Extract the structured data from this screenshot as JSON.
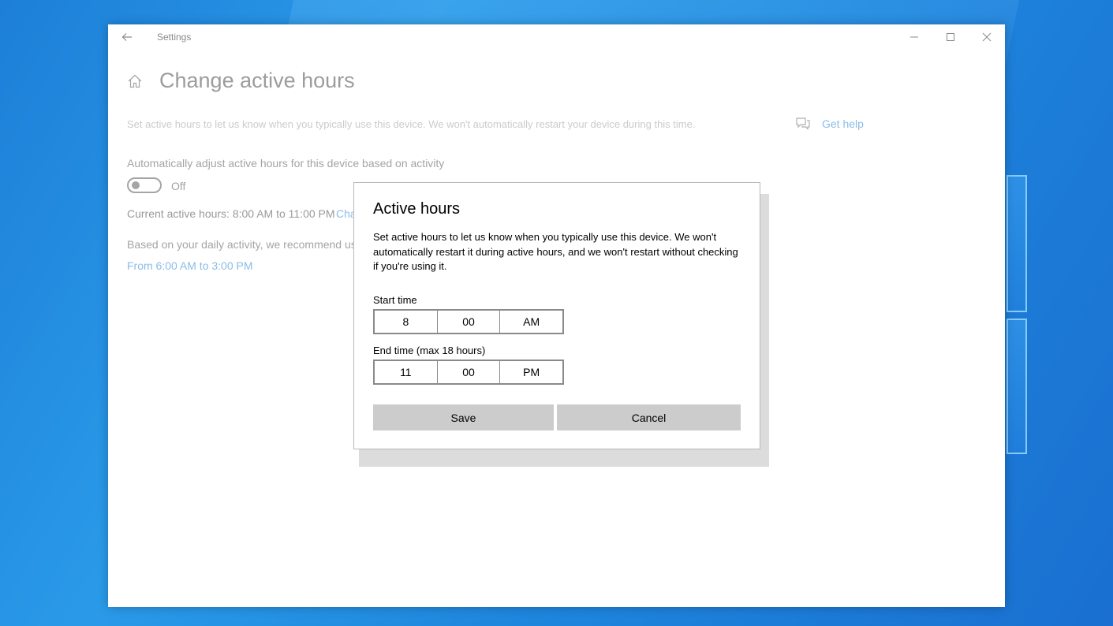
{
  "window": {
    "app_title": "Settings"
  },
  "page": {
    "title": "Change active hours",
    "description": "Set active hours to let us know when you typically use this device. We won't automatically restart your device during this time.",
    "get_help": "Get help",
    "auto_adjust_label": "Automatically adjust active hours for this device based on activity",
    "toggle_state": "Off",
    "current_hours": "Current active hours: 8:00 AM to 11:00 PM",
    "change_link": "Cha",
    "recommend_text": "Based on your daily activity, we recommend us",
    "recommend_link": "From 6:00 AM to 3:00 PM"
  },
  "dialog": {
    "title": "Active hours",
    "text": "Set active hours to let us know when you typically use this device. We won't automatically restart it during active hours, and we won't restart without checking if you're using it.",
    "start_label": "Start time",
    "start": {
      "hour": "8",
      "minute": "00",
      "period": "AM"
    },
    "end_label": "End time (max 18 hours)",
    "end": {
      "hour": "11",
      "minute": "00",
      "period": "PM"
    },
    "save": "Save",
    "cancel": "Cancel"
  },
  "colors": {
    "accent_link": "#3c8fd8",
    "desktop_blue": "#1e86dd",
    "button_gray": "#cccccc"
  },
  "icons": [
    "back-arrow-icon",
    "minimize-icon",
    "maximize-icon",
    "close-icon",
    "home-icon",
    "help-chat-icon"
  ]
}
